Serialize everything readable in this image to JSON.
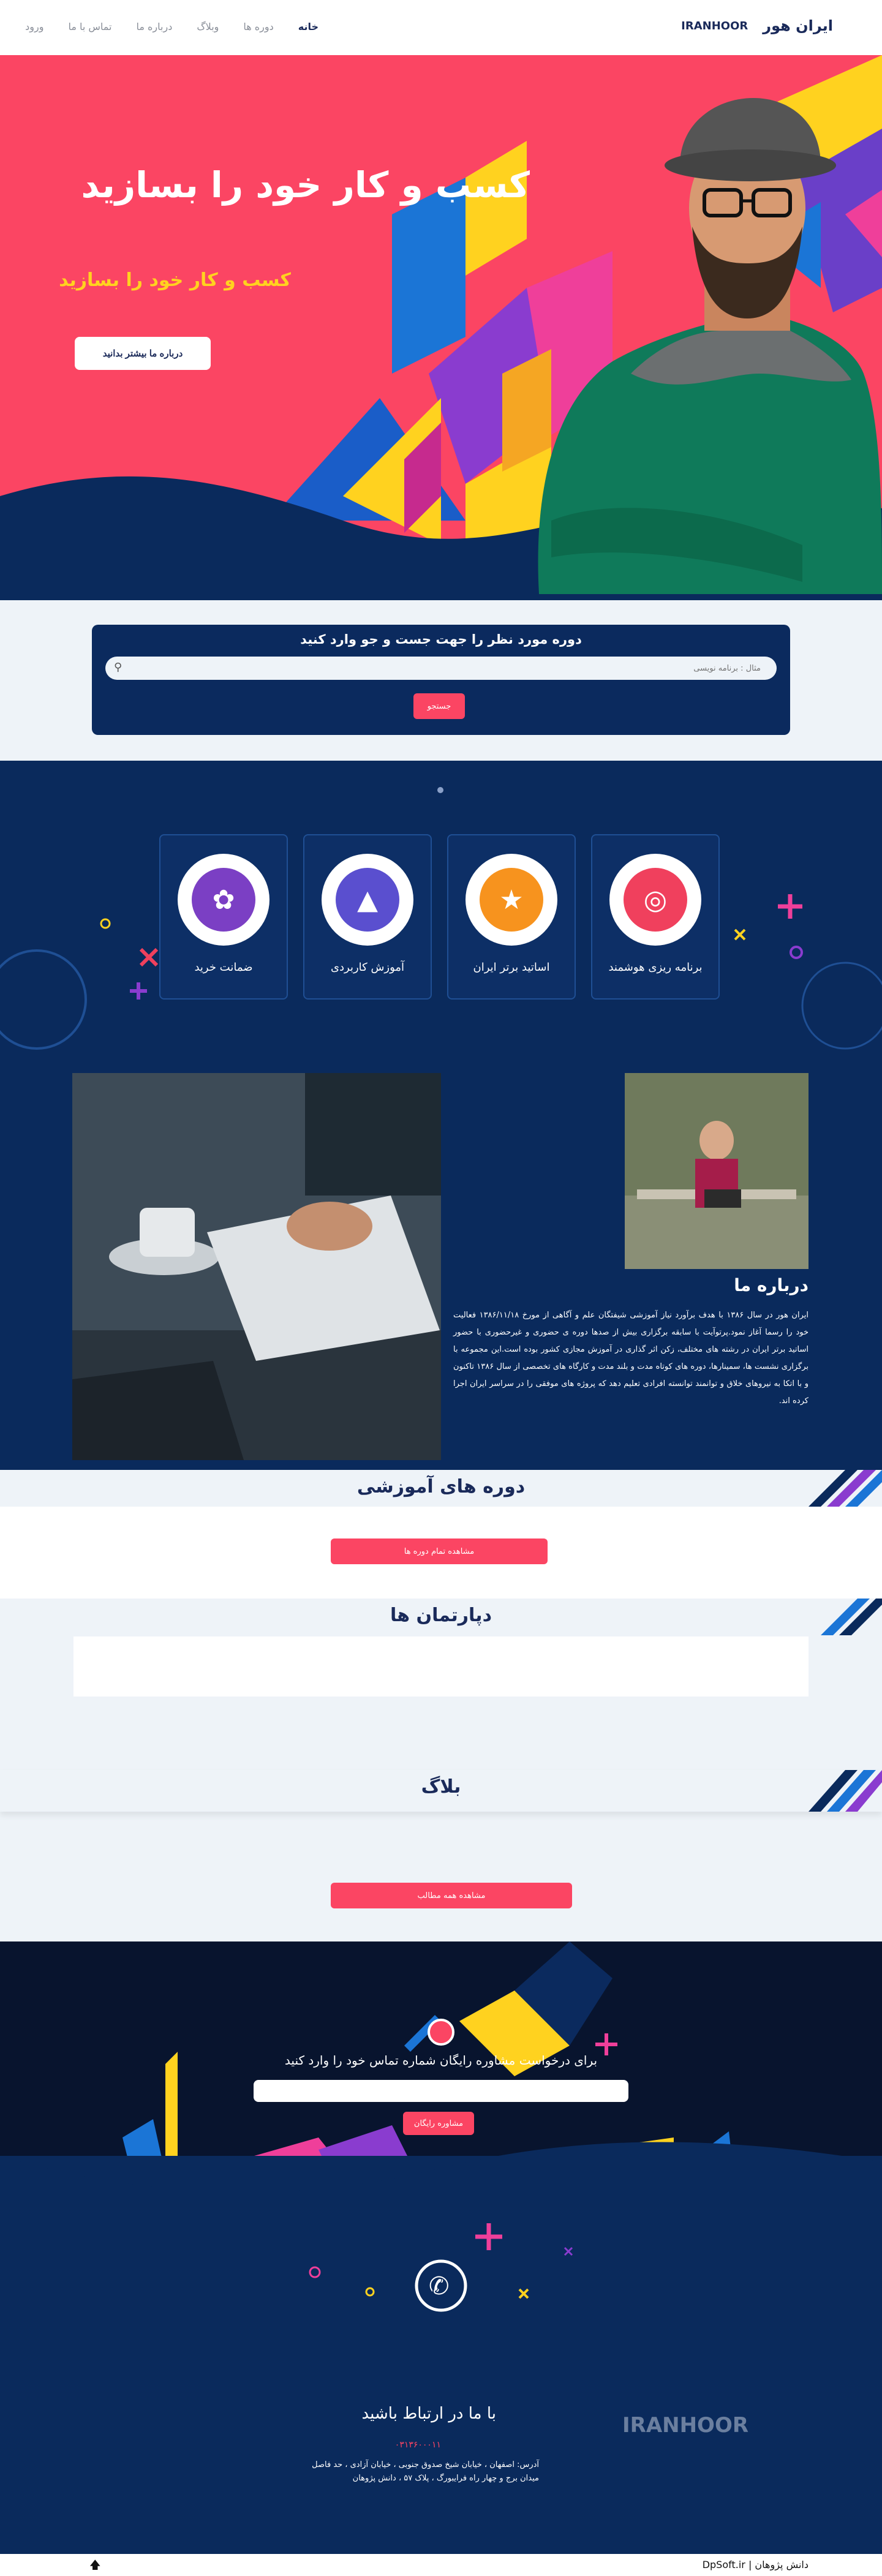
{
  "header": {
    "brand_fa": "ایران هور",
    "brand_en": "IRANHOOR",
    "nav": [
      "خانه",
      "دوره ها",
      "وبلاگ",
      "درباره ما",
      "تماس با ما",
      "ورود"
    ]
  },
  "hero": {
    "title": "کسب و کار خود را بسازید",
    "subtitle": "کسب و کار خود را بسازید",
    "button": "درباره ما بیشتر بدانید"
  },
  "search": {
    "title": "دوره مورد نظر را جهت جست و جو وارد کنید",
    "placeholder": "مثال : برنامه نویسی",
    "button": "جستجو"
  },
  "features": [
    {
      "label": "برنامه ریزی هوشمند",
      "icon": "target-icon",
      "color": "#f0405d"
    },
    {
      "label": "اساتید برتر ایران",
      "icon": "trophy-icon",
      "color": "#f7931e"
    },
    {
      "label": "آموزش کاربردی",
      "icon": "graduation-cap-icon",
      "color": "#5a4fcf"
    },
    {
      "label": "ضمانت خرید",
      "icon": "brain-icon",
      "color": "#7b3fc4"
    }
  ],
  "about": {
    "title": "درباره ما",
    "text": "ایران هور در سال ۱۳۸۶ با هدف برآورد نیاز آموزشی شیفتگان علم و آگاهی از مورخ ۱۳۸۶/۱۱/۱۸ فعالیت خود را رسما آغاز نمود.پرتوآیت با سابقه برگزاری بیش از صدها دوره ی حضوری و غیرحضوری با حضور اساتید برتر ایران در رشته های مختلف، زکن اثر گذاری در آموزش مجازی کشور بوده است.این مجموعه با برگزاری نشست ها، سمینارها، دوره های کوتاه مدت و بلند مدت و کارگاه های تخصصی از سال ۱۳۸۶ تاکنون و با اتکا به نیروهای خلاق و توانمند توانسته افرادی تعلیم دهد که پروژه های موفقی را در سراسر ایران اجرا کرده اند."
  },
  "courses": {
    "title": "دوره های آموزشی",
    "button": "مشاهده تمام دوره ها"
  },
  "departments": {
    "title": "دپارتمان ها"
  },
  "blog": {
    "title": "بلاگ",
    "button": "مشاهده همه مطالب"
  },
  "consult": {
    "title": "برای درخواست مشاوره رایگان شماره تماس خود را وارد کنید",
    "button": "مشاوره رایگان"
  },
  "footer": {
    "title": "با ما در ارتباط باشید",
    "phone": "۰۳۱۳۶۰۰۰۱۱",
    "address": "آدرس: اصفهان ، خیابان شیخ صدوق جنوبی ، خیابان آزادی ، حد فاصل میدان برج و چهار راه فرایبورگ ، پلاک ۵۷ ، دانش پژوهان",
    "brand": "IRANHOOR"
  },
  "bottom": {
    "credit": "دانش پژوهان | DpSoft.ir"
  },
  "colors": {
    "primary": "#fb4563",
    "navy": "#0a2a5c",
    "yellow": "#ffd21f",
    "text_dark": "#1a2a5a"
  }
}
